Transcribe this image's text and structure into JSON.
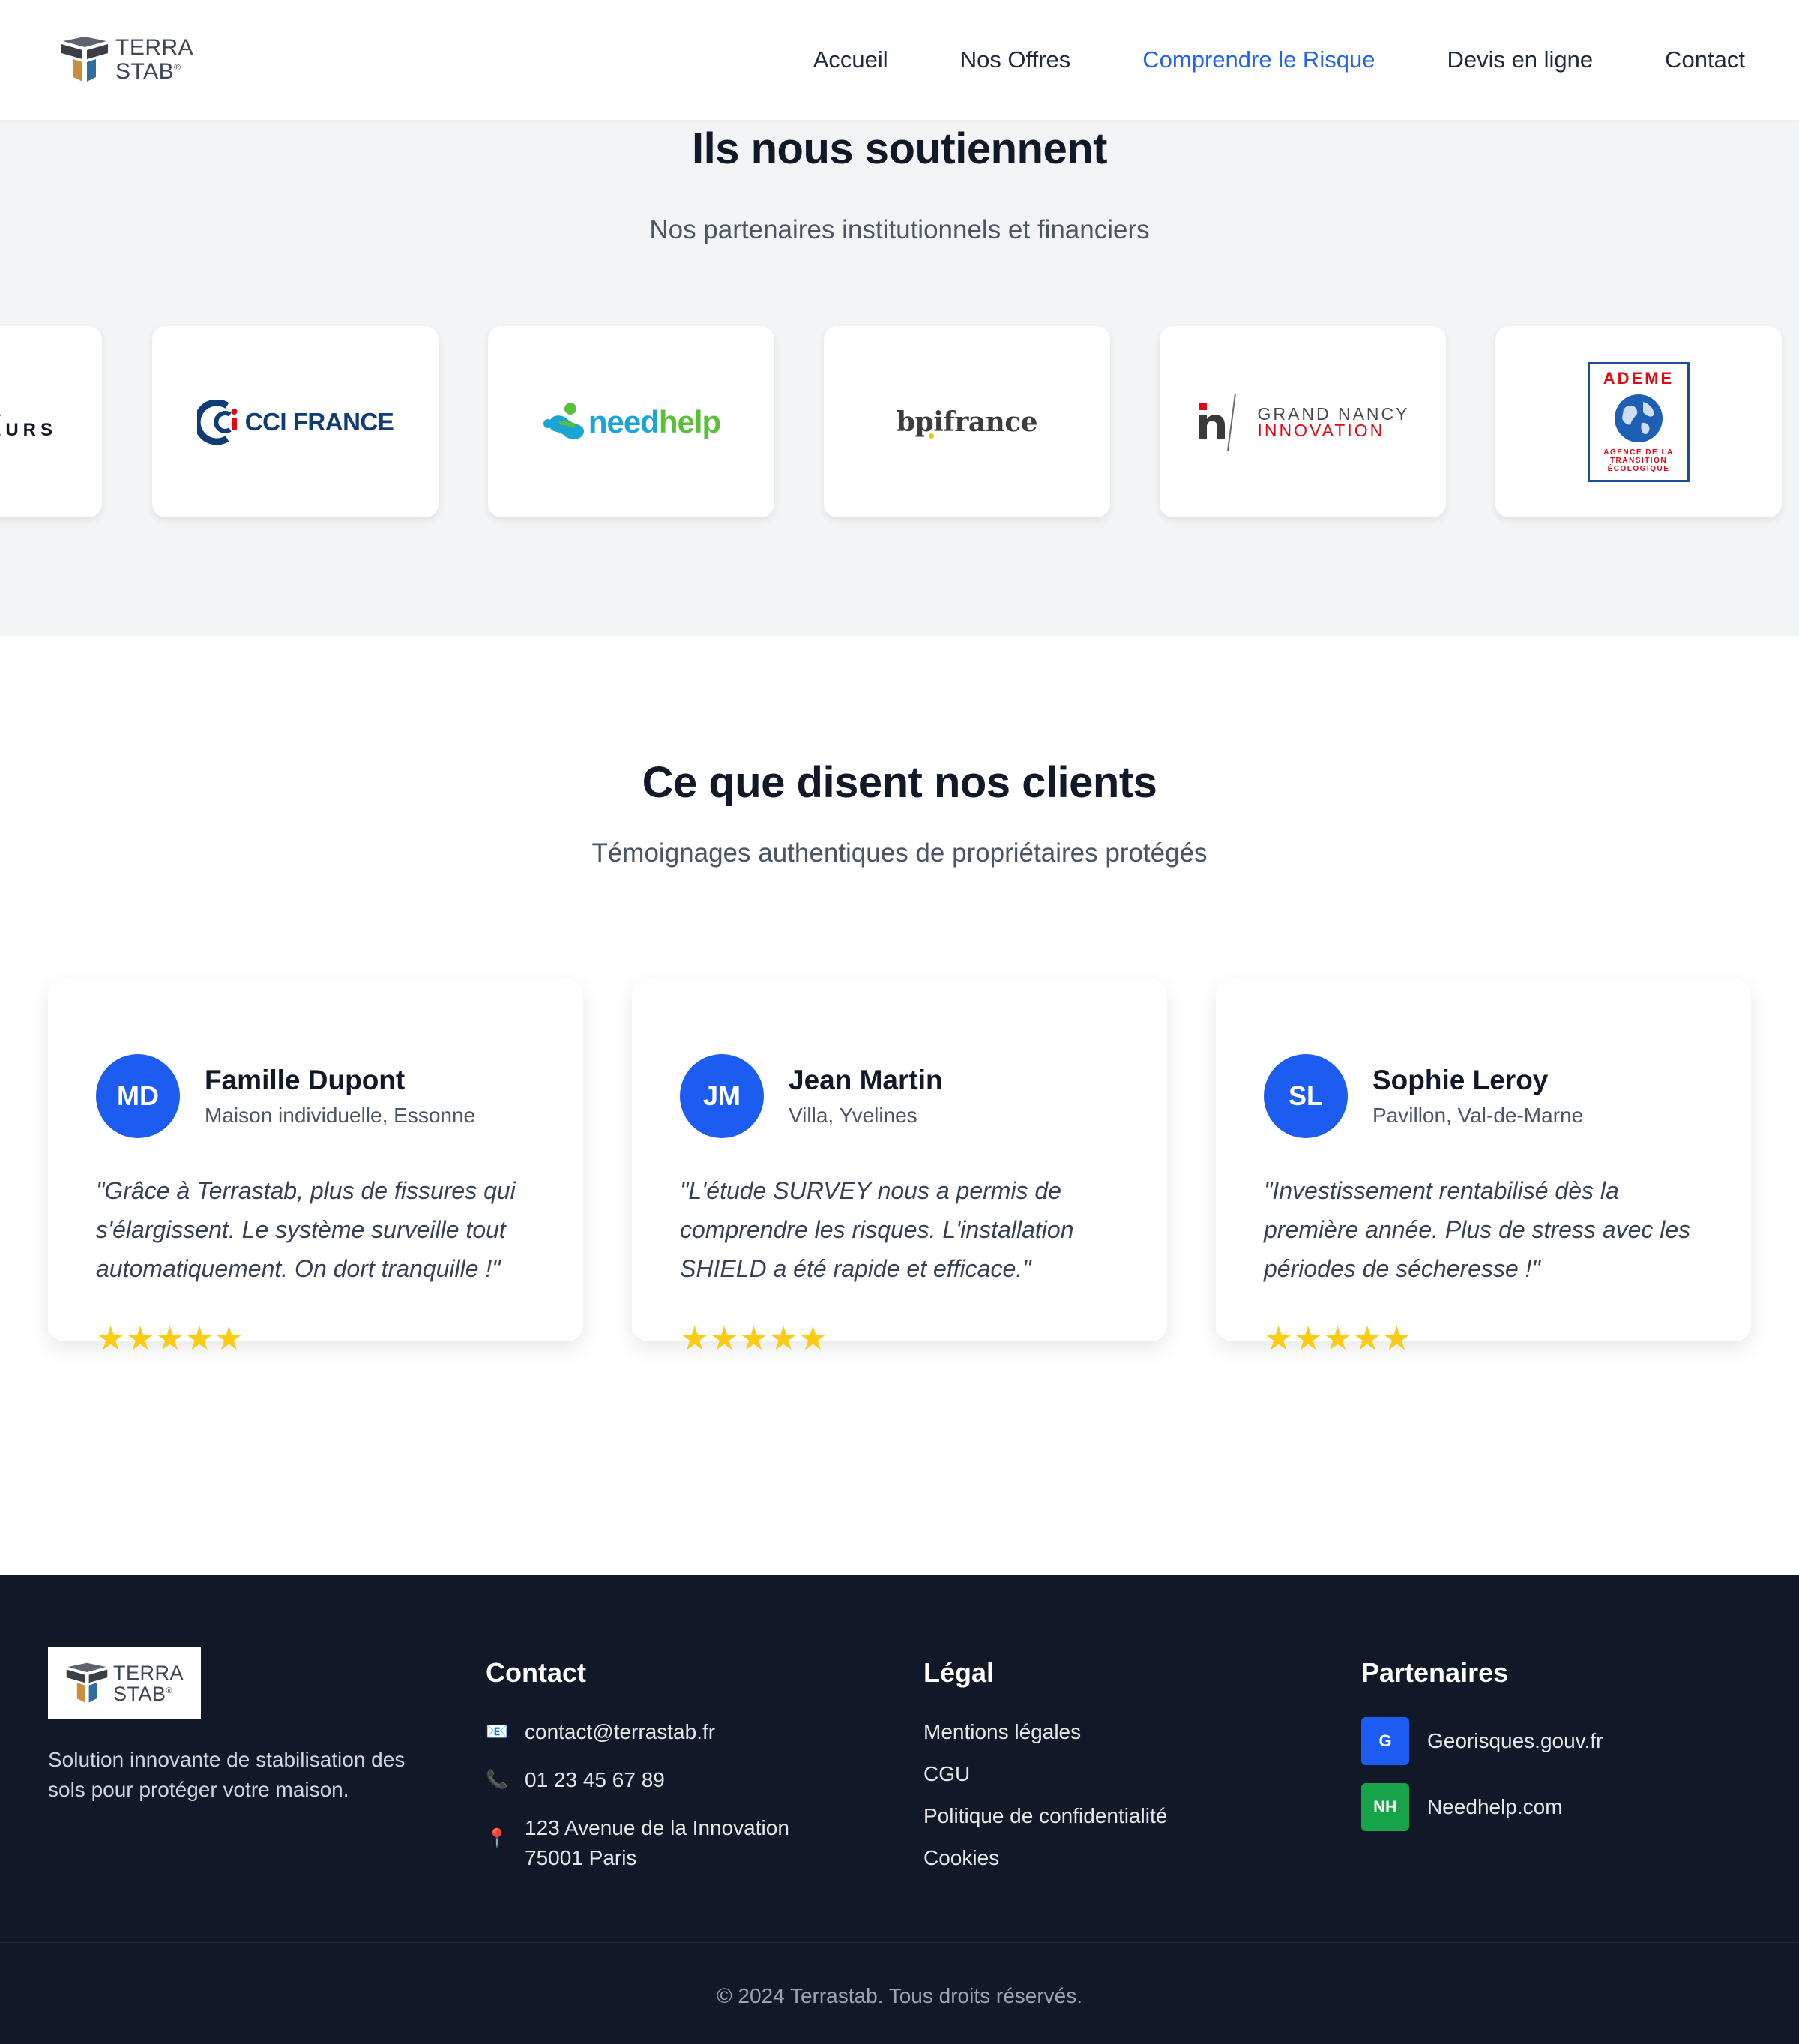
{
  "brand": {
    "line1": "TERRA",
    "line2": "STAB",
    "mark": "®"
  },
  "nav": [
    {
      "label": "Accueil",
      "active": false
    },
    {
      "label": "Nos Offres",
      "active": false
    },
    {
      "label": "Comprendre le Risque",
      "active": true
    },
    {
      "label": "Devis en ligne",
      "active": false
    },
    {
      "label": "Contact",
      "active": false
    }
  ],
  "partners": {
    "title": "Ils nous soutiennent",
    "subtitle": "Nos partenaires institutionnels et financiers",
    "logos": [
      {
        "name": "partial",
        "text": "EURS",
        "partial_mark": "E"
      },
      {
        "name": "cci-france",
        "text": "CCI FRANCE"
      },
      {
        "name": "needhelp",
        "text_a": "need",
        "text_b": "help"
      },
      {
        "name": "bpifrance",
        "text_a": "bpi",
        "text_b": "france"
      },
      {
        "name": "grand-nancy",
        "line1": "GRAND NANCY",
        "line2": "INNOVATION"
      },
      {
        "name": "ademe",
        "title": "ADEME",
        "l1": "AGENCE DE LA",
        "l2": "TRANSITION",
        "l3": "ÉCOLOGIQUE"
      }
    ]
  },
  "testimonials": {
    "title": "Ce que disent nos clients",
    "subtitle": "Témoignages authentiques de propriétaires protégés",
    "items": [
      {
        "initials": "MD",
        "name": "Famille Dupont",
        "location": "Maison individuelle, Essonne",
        "quote": "\"Grâce à Terrastab, plus de fissures qui s'élargissent. Le système surveille tout automatiquement. On dort tranquille !\"",
        "rating": 5,
        "stars": "★★★★★"
      },
      {
        "initials": "JM",
        "name": "Jean Martin",
        "location": "Villa, Yvelines",
        "quote": "\"L'étude SURVEY nous a permis de comprendre les risques. L'installation SHIELD a été rapide et efficace.\"",
        "rating": 5,
        "stars": "★★★★★"
      },
      {
        "initials": "SL",
        "name": "Sophie Leroy",
        "location": "Pavillon, Val-de-Marne",
        "quote": "\"Investissement rentabilisé dès la première année. Plus de stress avec les périodes de sécheresse !\"",
        "rating": 5,
        "stars": "★★★★★"
      }
    ]
  },
  "footer": {
    "description": "Solution innovante de stabilisation des sols pour protéger votre maison.",
    "contact": {
      "heading": "Contact",
      "email": "contact@terrastab.fr",
      "phone": "01 23 45 67 89",
      "address_line1": "123 Avenue de la Innovation",
      "address_line2": "75001 Paris",
      "email_icon": "📧",
      "phone_icon": "📞",
      "pin_icon": "📍"
    },
    "legal": {
      "heading": "Légal",
      "links": [
        "Mentions légales",
        "CGU",
        "Politique de confidentialité",
        "Cookies"
      ]
    },
    "partners": {
      "heading": "Partenaires",
      "items": [
        {
          "badge": "G",
          "label": "Georisques.gouv.fr",
          "color": "#1d5cf0"
        },
        {
          "badge": "NH",
          "label": "Needhelp.com",
          "color": "#16a34a"
        }
      ]
    },
    "copyright": "© 2024 Terrastab. Tous droits réservés."
  },
  "colors": {
    "accent": "#2563eb",
    "avatar": "#1d5cf0",
    "star": "#facc15",
    "footer_bg": "#111827",
    "partners_bg": "#f3f4f6"
  }
}
